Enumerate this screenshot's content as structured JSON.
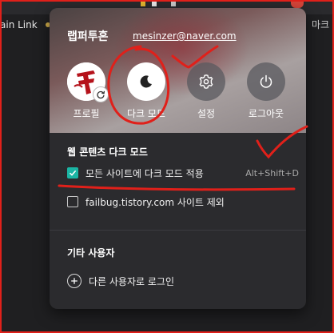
{
  "background": {
    "bookmark_label": "ain Link",
    "right_label": "마크"
  },
  "profile": {
    "name": "랩퍼투혼",
    "email": "mesinzer@naver.com"
  },
  "actions": [
    {
      "label": "프로필",
      "icon": "avatar"
    },
    {
      "label": "다크 모드",
      "icon": "moon-icon"
    },
    {
      "label": "설정",
      "icon": "gear-icon"
    },
    {
      "label": "로그아웃",
      "icon": "power-icon"
    }
  ],
  "web_dark_mode": {
    "title": "웹 콘텐츠 다크 모드",
    "apply_all": {
      "label": "모든 사이트에 다크 모드 적용",
      "shortcut": "Alt+Shift+D",
      "checked": true
    },
    "exclude_site": {
      "label": "failbug.tistory.com 사이트 제외",
      "checked": false
    }
  },
  "other_users": {
    "title": "기타 사용자",
    "login_other": "다른 사용자로 로그인"
  },
  "colors": {
    "accent_check": "#1bb5a4",
    "annotation_red": "#e0201a",
    "panel_bg": "#2b2b2e"
  }
}
